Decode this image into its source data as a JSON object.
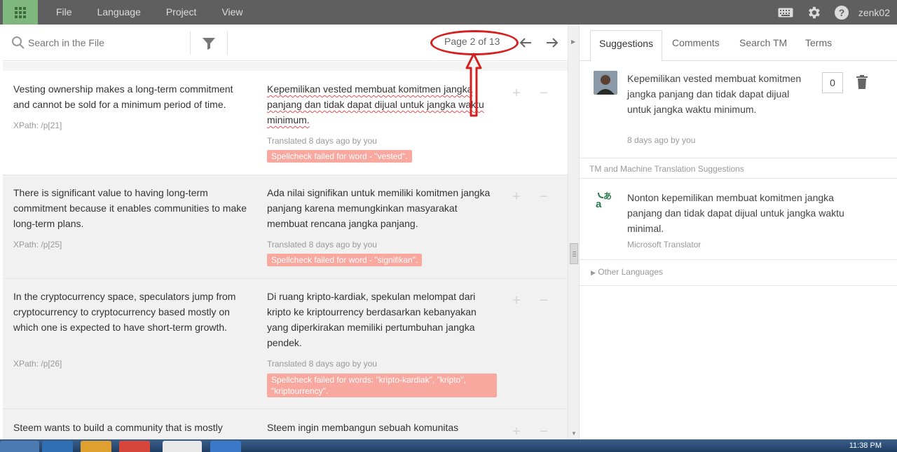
{
  "menu": [
    "File",
    "Language",
    "Project",
    "View"
  ],
  "user": {
    "name": "zenk02"
  },
  "toolbar": {
    "search_placeholder": "Search in the File",
    "page_indicator": "Page 2 of 13"
  },
  "segments": [
    {
      "source": "Vesting ownership makes a long-term commitment and cannot be sold for a minimum period of time.",
      "xpath": "XPath: /p[21]",
      "target": "Kepemilikan vested membuat komitmen jangka panjang dan tidak dapat dijual untuk jangka waktu minimum.",
      "meta": "Translated 8 days ago by you",
      "spellcheck": "Spellcheck failed for word - \"vested\"."
    },
    {
      "source": "There is significant value to having long-term commitment because it enables communities to make long-term plans.",
      "xpath": "XPath: /p[25]",
      "target": "Ada nilai signifikan untuk memiliki komitmen jangka panjang karena memungkinkan masyarakat membuat rencana jangka panjang.",
      "meta": "Translated 8 days ago by you",
      "spellcheck": "Spellcheck failed for word - \"signifikan\"."
    },
    {
      "source": "In the cryptocurrency space, speculators jump from cryptocurrency to cryptocurrency based mostly on which one is expected to have short-term growth.",
      "xpath": "XPath: /p[26]",
      "target": "Di ruang kripto-kardiak, spekulan melompat dari kripto ke kriptourrency berdasarkan kebanyakan yang diperkirakan memiliki pertumbuhan jangka pendek.",
      "meta": "Translated 8 days ago by you",
      "spellcheck": "Spellcheck failed for words: \"kripto-kardiak\", \"kripto\", \"kriptourrency\"."
    },
    {
      "source": "Steem wants to build a community that is mostly",
      "target": "Steem ingin membangun sebuah komunitas"
    }
  ],
  "right_panel": {
    "tabs": [
      "Suggestions",
      "Comments",
      "Search TM",
      "Terms"
    ],
    "suggestion": {
      "text": "Kepemilikan vested membuat komitmen jangka panjang dan tidak dapat dijual untuk jangka waktu minimum.",
      "meta": "8 days ago by you",
      "votes": "0"
    },
    "tm_section_label": "TM and Machine Translation Suggestions",
    "mt": {
      "text": "Nonton kepemilikan membuat komitmen jangka panjang dan tidak dapat dijual untuk jangka waktu minimal.",
      "source": "Microsoft Translator"
    },
    "other_languages": "Other Languages"
  },
  "taskbar": {
    "clock": "11:38 PM"
  },
  "colors": {
    "topbar": "#5f5f5f",
    "app_button": "#7fb87f",
    "spell_badge": "#f9a8a0",
    "annotation": "#d62020"
  }
}
